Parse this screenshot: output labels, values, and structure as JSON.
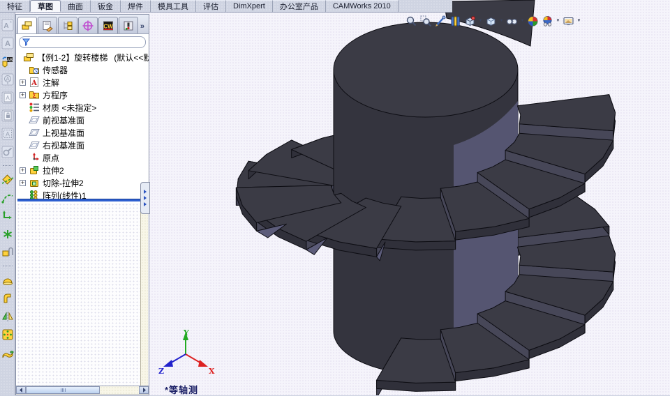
{
  "command_tabs": [
    {
      "label": "特征",
      "active": false
    },
    {
      "label": "草图",
      "active": true
    },
    {
      "label": "曲面",
      "active": false
    },
    {
      "label": "钣金",
      "active": false
    },
    {
      "label": "焊件",
      "active": false
    },
    {
      "label": "模具工具",
      "active": false
    },
    {
      "label": "评估",
      "active": false
    },
    {
      "label": "DimXpert",
      "active": false
    },
    {
      "label": "办公室产品",
      "active": false
    },
    {
      "label": "CAMWorks 2010",
      "active": false
    }
  ],
  "panel_tabs": {
    "icons": [
      {
        "icon": "featuremanager-tree",
        "active": true
      },
      {
        "icon": "propertymanager",
        "active": false
      },
      {
        "icon": "configurationmanager",
        "active": false
      },
      {
        "icon": "dimxpertmanager",
        "active": false
      },
      {
        "icon": "camworks-feature-tree",
        "active": false
      },
      {
        "icon": "camworks-operation-tree",
        "active": false
      }
    ],
    "overflow_chevron": "»"
  },
  "feature_tree": {
    "filter": {
      "value": "",
      "icon": "filter-funnel-icon"
    },
    "root": {
      "label": "【例1-2】旋转楼梯",
      "config_suffix": "(默认<<默认",
      "icon": "part"
    },
    "items": [
      {
        "label": "传感器",
        "icon": "sensors",
        "expandable": false
      },
      {
        "label": "注解",
        "icon": "annotations",
        "expandable": true
      },
      {
        "label": "方程序",
        "icon": "equations",
        "expandable": true
      },
      {
        "label": "材质 <未指定>",
        "icon": "material",
        "expandable": false
      },
      {
        "label": "前视基准面",
        "icon": "plane",
        "expandable": false
      },
      {
        "label": "上视基准面",
        "icon": "plane",
        "expandable": false
      },
      {
        "label": "右视基准面",
        "icon": "plane",
        "expandable": false
      },
      {
        "label": "原点",
        "icon": "origin",
        "expandable": false
      },
      {
        "label": "拉伸2",
        "icon": "extrude",
        "expandable": true
      },
      {
        "label": "切除-拉伸2",
        "icon": "cut-extrude",
        "expandable": true
      },
      {
        "label": "阵列(线性)1",
        "icon": "linear-pattern",
        "expandable": false
      }
    ]
  },
  "headsup_toolbar": [
    {
      "icon": "zoom-to-fit",
      "dropdown": false
    },
    {
      "icon": "zoom-to-area",
      "dropdown": false
    },
    {
      "icon": "zoom-pen",
      "dropdown": false
    },
    {
      "icon": "section-view",
      "dropdown": false
    },
    {
      "icon": "view-orientation",
      "dropdown": true
    },
    {
      "icon": "display-style",
      "dropdown": true
    },
    {
      "icon": "hide-show-items",
      "dropdown": true
    },
    {
      "icon": "apply-scene",
      "dropdown": false
    },
    {
      "icon": "view-settings",
      "dropdown": true
    },
    {
      "icon": "camera-display",
      "dropdown": true
    }
  ],
  "left_toolbar": [
    {
      "icon": "a-star",
      "disabled": true
    },
    {
      "icon": "a-note",
      "disabled": true
    },
    {
      "icon": "spellcheck-ab",
      "disabled": false
    },
    {
      "icon": "balloon-a",
      "disabled": true
    },
    {
      "icon": "doc-a",
      "disabled": true
    },
    {
      "icon": "doc-lock",
      "disabled": true
    },
    {
      "icon": "boxed-a",
      "disabled": true
    },
    {
      "icon": "wrench-gear",
      "disabled": true
    },
    {
      "sep": true
    },
    {
      "icon": "diamond-snap",
      "disabled": false
    },
    {
      "icon": "green-spline",
      "disabled": false
    },
    {
      "icon": "move-arrows",
      "disabled": false
    },
    {
      "icon": "green-asterisk",
      "disabled": false
    },
    {
      "icon": "paperclip-attach",
      "disabled": false
    },
    {
      "sep": true
    },
    {
      "icon": "dome-feature",
      "disabled": false
    },
    {
      "icon": "bend-feature",
      "disabled": false
    },
    {
      "icon": "mirror-feature",
      "disabled": false
    },
    {
      "icon": "circular-pattern",
      "disabled": false
    },
    {
      "icon": "sweep-feature",
      "disabled": false
    }
  ],
  "viewport": {
    "view_label": "*等轴测",
    "triad": {
      "x": "X",
      "y": "Y",
      "z": "Z"
    }
  },
  "colors": {
    "chrome": "#ccd2e0",
    "viewport_bg": "#f5f4fb",
    "rollback_blue": "#2d5fd0",
    "model_face": "#3b3b45",
    "model_cylinder": "#34343e",
    "model_wall": "#30303a",
    "model_riser": "#474758",
    "model_light": "#5c5c7a",
    "model_edge": "#0d0d13",
    "triad_x": "#dd2222",
    "triad_y": "#22aa22",
    "triad_z": "#2222cc"
  }
}
